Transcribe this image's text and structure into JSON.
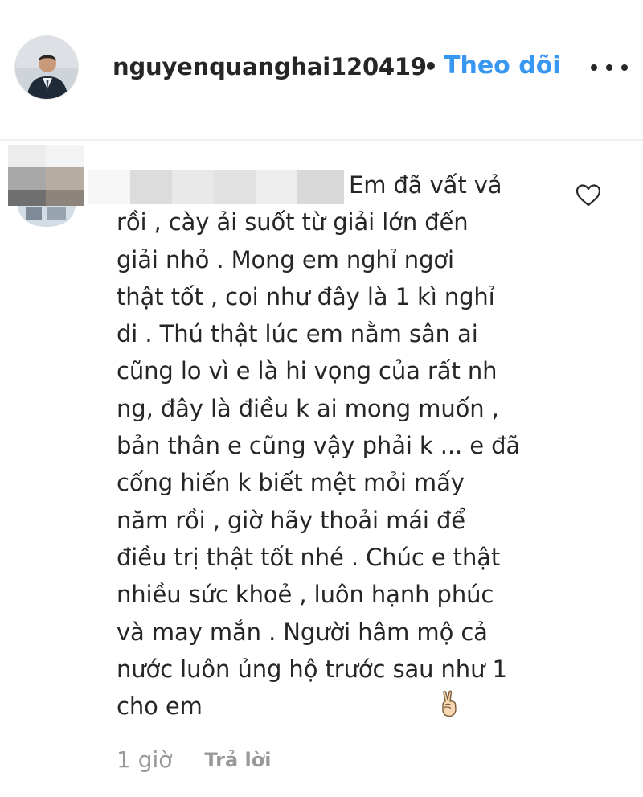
{
  "post_header": {
    "username": "nguyenquanghai120419",
    "separator": "•",
    "follow_label": "Theo dõi",
    "more_icon": "more-horizontal-icon"
  },
  "comment": {
    "commenter_name": "",
    "text": "Em đã vất vả\nrồi , cày ải suốt từ giải lớn đến\ngiải nhỏ . Mong em nghỉ ngơi\nthật tốt , coi như đây là 1 kì nghỉ\ndi . Thú thật lúc em nằm sân ai\ncũng lo vì e là hi vọng của rất nh\nng, đây là điều k ai mong muốn ,\nbản thân e cũng vậy phải k ... e đã\ncống hiến k biết mệt mỏi mấy\nnăm rồi , giờ hãy thoải mái để\nđiều trị thật tốt nhé . Chúc e thật\nnhiều sức khoẻ , luôn hạnh phúc\nvà may mắn . Người hâm mộ cả\nnước luôn ủng hộ trước sau như 1\ncho em",
    "emoji_icon": "victory-hand-emoji",
    "like_icon": "heart-icon",
    "time": "1 giờ",
    "reply_label": "Trả lời"
  },
  "colors": {
    "text": "#262626",
    "link": "#3897f0",
    "muted": "#999999",
    "divider": "#efefef"
  }
}
